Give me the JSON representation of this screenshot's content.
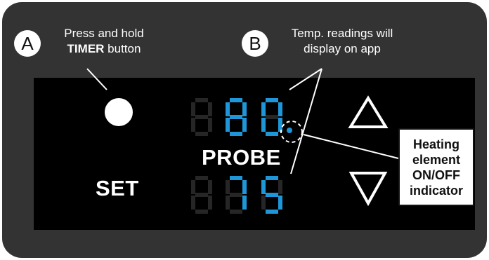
{
  "callout_a": {
    "badge": "A",
    "line1": "Press and hold",
    "bold_word": "TIMER",
    "rest_word": " button"
  },
  "callout_b": {
    "badge": "B",
    "line1": "Temp. readings will",
    "line2": "display on app"
  },
  "display": {
    "top_reading": "80",
    "bottom_reading": "75",
    "probe_label": "PROBE",
    "set_label": "SET",
    "digit_color": "#1e96d8",
    "ghost_segment_color": "#262626"
  },
  "heating_indicator": {
    "line1": "Heating",
    "line2": "element",
    "line3": "ON/OFF",
    "line4": "indicator"
  },
  "icons": {
    "timer": "timer-pie-icon",
    "up": "up-arrow-triangle-icon",
    "down": "down-arrow-triangle-icon",
    "indicator_dot": "heating-dot-icon"
  }
}
